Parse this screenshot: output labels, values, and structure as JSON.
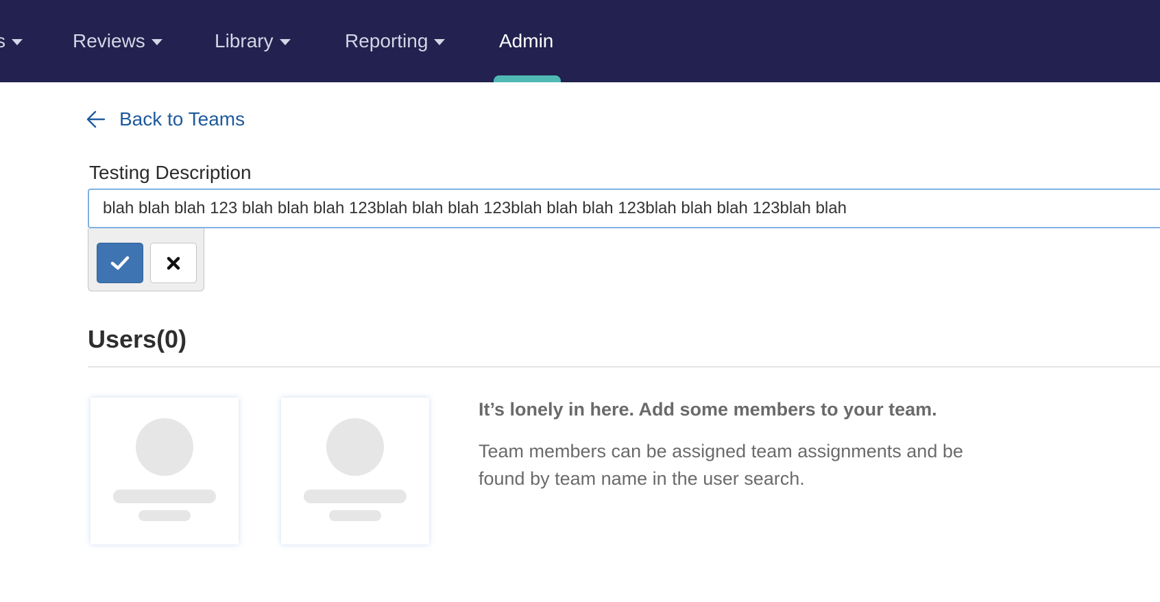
{
  "nav": {
    "items": [
      {
        "label": "s"
      },
      {
        "label": "Reviews"
      },
      {
        "label": "Library"
      },
      {
        "label": "Reporting"
      },
      {
        "label": "Admin"
      }
    ],
    "active_item": "Admin",
    "indicator_color": "#4fb9b4",
    "background_color": "#22214f"
  },
  "back_link": {
    "label": "Back to Teams",
    "icon": "arrow-left-icon"
  },
  "description_editor": {
    "label": "Testing Description",
    "value": "blah blah blah 123 blah blah blah 123blah blah blah 123blah blah blah 123blah blah blah 123blah blah",
    "confirm_icon": "checkmark-icon",
    "cancel_icon": "close-icon",
    "confirm_color": "#3f74b2"
  },
  "users_section": {
    "title": "Users(0)",
    "empty_state": {
      "heading": "It’s lonely in here. Add some members to your team.",
      "body": "Team members can be assigned team assignments and be found by team name in the user search."
    }
  }
}
